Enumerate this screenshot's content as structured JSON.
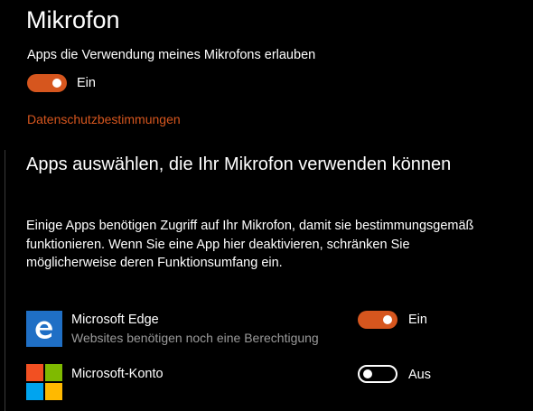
{
  "colors": {
    "accent": "#d6561e",
    "background": "#000000",
    "text": "#ffffff",
    "secondary_text": "#9a9a9a",
    "edge_tile": "#1f6fc5"
  },
  "page": {
    "title": "Mikrofon"
  },
  "mic_access": {
    "label": "Apps die Verwendung meines Mikrofons erlauben",
    "toggle_state": "on",
    "toggle_text": "Ein"
  },
  "privacy_link": "Datenschutzbestimmungen",
  "apps_section": {
    "heading": "Apps auswählen, die Ihr Mikrofon verwenden können",
    "description": "Einige Apps benötigen Zugriff auf Ihr Mikrofon, damit sie bestimmungsgemäß funktionieren. Wenn Sie eine App hier deaktivieren, schränken Sie möglicherweise deren Funktionsumfang ein.",
    "apps": [
      {
        "name": "Microsoft Edge",
        "subtitle": "Websites benötigen noch eine Berechtigung",
        "icon": "microsoft-edge-icon",
        "toggle_state": "on",
        "toggle_text": "Ein"
      },
      {
        "name": "Microsoft-Konto",
        "icon": "microsoft-logo-icon",
        "toggle_state": "off",
        "toggle_text": "Aus"
      }
    ]
  }
}
